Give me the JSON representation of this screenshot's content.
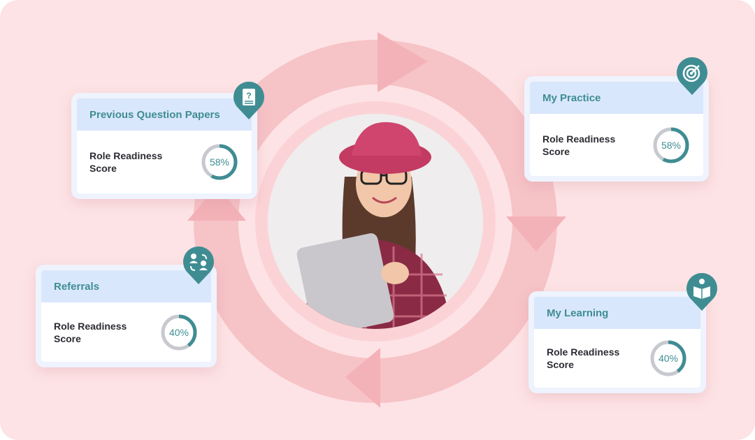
{
  "colors": {
    "background": "#fde3e5",
    "cycle": "#f6bcc0",
    "card_header": "#d9e7fc",
    "accent_teal": "#3f8d93",
    "ring_track": "#c7c9cf"
  },
  "cards": [
    {
      "title": "Previous Question Papers",
      "score_label": "Role Readiness Score",
      "score_text": "58%",
      "score_value": 58,
      "icon": "question-paper-icon"
    },
    {
      "title": "My Practice",
      "score_label": "Role Readiness Score",
      "score_text": "58%",
      "score_value": 58,
      "icon": "target-icon"
    },
    {
      "title": "Referrals",
      "score_label": "Role Readiness Score",
      "score_text": "40%",
      "score_value": 40,
      "icon": "referral-users-icon"
    },
    {
      "title": "My Learning",
      "score_label": "Role Readiness Score",
      "score_text": "40%",
      "score_value": 40,
      "icon": "reading-person-icon"
    }
  ],
  "center_image": {
    "subject": "smiling student with laptop",
    "icon": "student-photo"
  }
}
